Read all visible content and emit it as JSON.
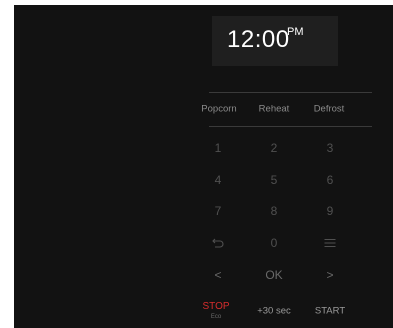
{
  "display": {
    "time": "12:00",
    "period": "PM"
  },
  "functions": {
    "popcorn": "Popcorn",
    "reheat": "Reheat",
    "defrost": "Defrost"
  },
  "keypad": {
    "k1": "1",
    "k2": "2",
    "k3": "3",
    "k4": "4",
    "k5": "5",
    "k6": "6",
    "k7": "7",
    "k8": "8",
    "k9": "9",
    "k0": "0"
  },
  "icons": {
    "back": "back-arrow-icon",
    "menu": "menu-icon"
  },
  "navigation": {
    "left": "<",
    "ok": "OK",
    "right": ">"
  },
  "bottom": {
    "stop": "STOP",
    "stop_sub": "Eco",
    "add30": "+30 sec",
    "start": "START"
  },
  "colors": {
    "panel": "#121212",
    "display": "#1f1f1f",
    "stop": "#d62d2d"
  }
}
